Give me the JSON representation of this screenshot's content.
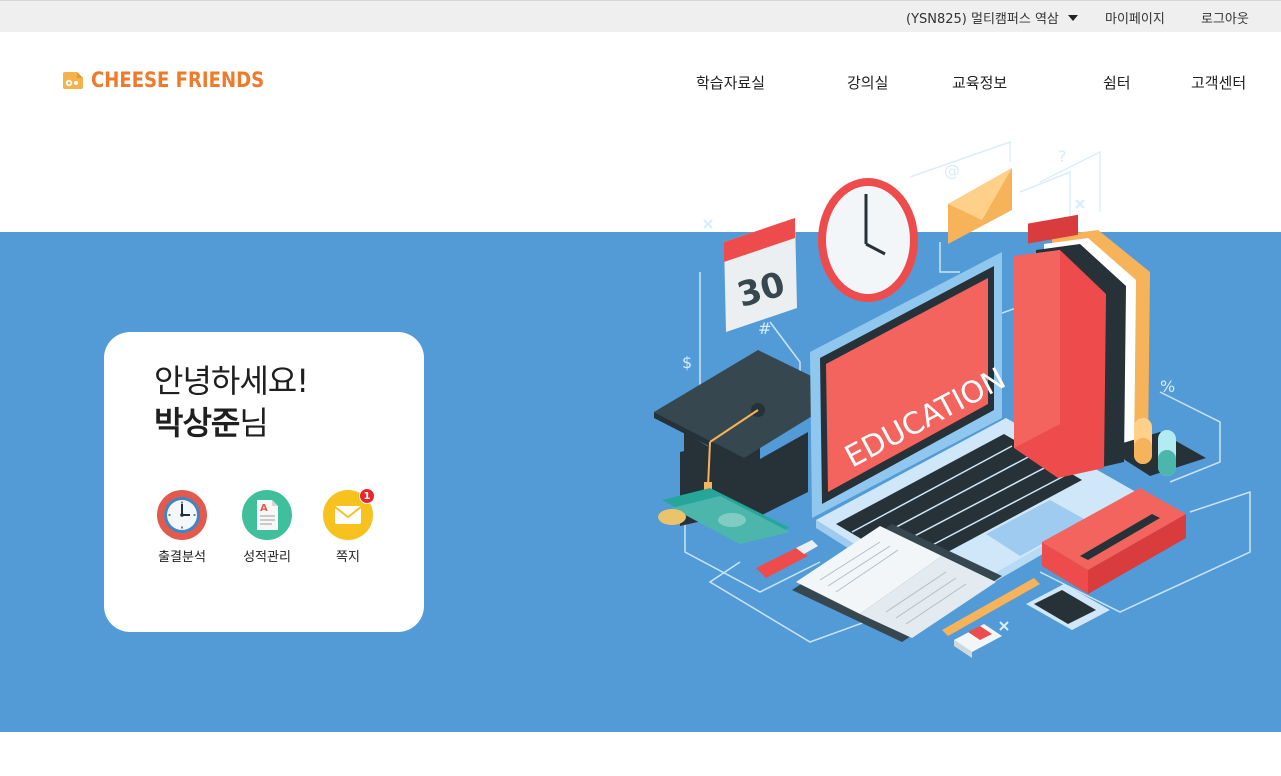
{
  "topbar": {
    "campus": "(YSN825) 멀티캠퍼스 역삼",
    "mypage": "마이페이지",
    "logout": "로그아웃"
  },
  "logo": {
    "text": "CHEESE FRIENDS"
  },
  "nav": [
    "학습자료실",
    "강의실",
    "교육정보",
    "쉼터",
    "고객센터"
  ],
  "welcome": {
    "greeting": "안녕하세요!",
    "name": "박상준",
    "suffix": "님"
  },
  "quick_menu": [
    {
      "label": "출결분석",
      "icon": "clock-icon"
    },
    {
      "label": "성적관리",
      "icon": "grade-document-icon"
    },
    {
      "label": "쪽지",
      "icon": "envelope-icon",
      "badge": "1"
    }
  ],
  "illustration": {
    "screen_text": "EDUCATION",
    "calendar_day": "30",
    "email_symbol": "@",
    "question_mark": "?",
    "percent": "%",
    "dollar": "$",
    "hash": "#"
  },
  "colors": {
    "hero_bg": "#539bd7",
    "brand_orange": "#ef7a2a",
    "badge_red": "#e8262b"
  }
}
